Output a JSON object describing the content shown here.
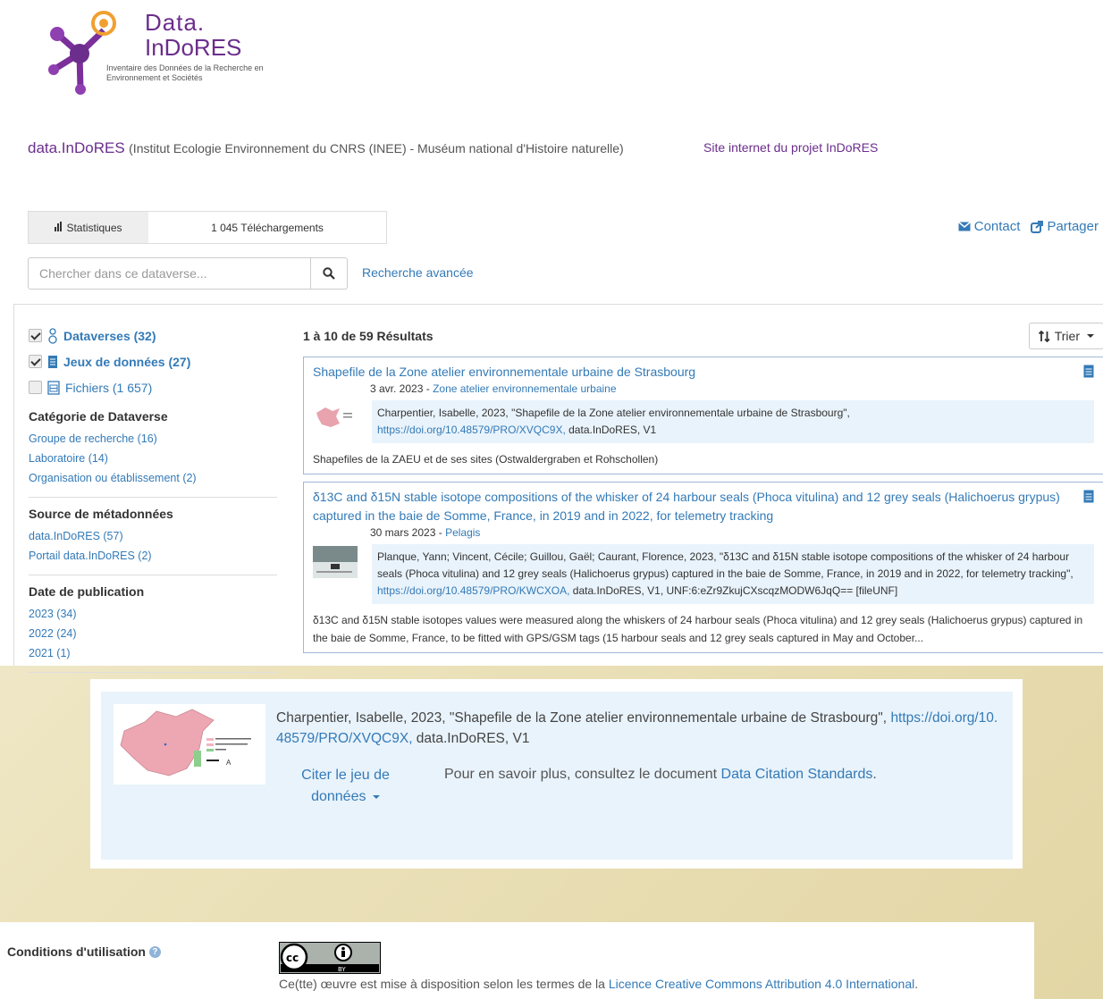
{
  "logo": {
    "line1": "Data.",
    "line2": "InDoRES",
    "line3": "Inventaire des Données de la Recherche en Environnement et Sociétés"
  },
  "header": {
    "brand": "data.InDoRES",
    "subtitle": "(Institut Ecologie Environnement du CNRS (INEE) - Muséum national d'Histoire naturelle)",
    "site_link": "Site internet du projet InDoRES"
  },
  "stats": {
    "label": "Statistiques",
    "downloads": "1 045 Téléchargements"
  },
  "toplinks": {
    "contact": "Contact",
    "share": "Partager"
  },
  "search": {
    "placeholder": "Chercher dans ce dataverse...",
    "advanced": "Recherche avancée"
  },
  "facets": {
    "types": [
      {
        "label": "Dataverses (32)",
        "checked": true
      },
      {
        "label": "Jeux de données (27)",
        "checked": true
      },
      {
        "label": "Fichiers (1 657)",
        "checked": false
      }
    ],
    "groups": [
      {
        "title": "Catégorie de Dataverse",
        "items": [
          "Groupe de recherche (16)",
          "Laboratoire (14)",
          "Organisation ou établissement (2)"
        ]
      },
      {
        "title": "Source de métadonnées",
        "items": [
          "data.InDoRES (57)",
          "Portail data.InDoRES (2)"
        ]
      },
      {
        "title": "Date de publication",
        "items": [
          "2023 (34)",
          "2022 (24)",
          "2021 (1)"
        ]
      }
    ]
  },
  "results": {
    "count": "1 à 10 de 59 Résultats",
    "sort": "Trier",
    "items": [
      {
        "title": "Shapefile de la Zone atelier environnementale urbaine de Strasbourg",
        "date": "3 avr. 2023 -",
        "dataverse": "Zone atelier environnementale urbaine",
        "cite_text": "Charpentier, Isabelle, 2023, \"Shapefile de la Zone atelier environnementale urbaine de Strasbourg\",",
        "cite_doi": "https://doi.org/10.48579/PRO/XVQC9X,",
        "cite_tail": " data.InDoRES, V1",
        "desc": "Shapefiles de la ZAEU et de ses sites (Ostwaldergraben et Rohschollen)"
      },
      {
        "title": "δ13C and δ15N stable isotope compositions of the whisker of 24 harbour seals (Phoca vitulina) and 12 grey seals (Halichoerus grypus) captured in the baie de Somme, France, in 2019 and in 2022, for telemetry tracking",
        "date": "30 mars 2023 -",
        "dataverse": "Pelagis",
        "cite_text": "Planque, Yann; Vincent, Cécile; Guillou, Gaël; Caurant, Florence, 2023, \"δ13C and δ15N stable isotope compositions of the whisker of 24 harbour seals (Phoca vitulina) and 12 grey seals (Halichoerus grypus) captured in the baie de Somme, France, in 2019 and in 2022, for telemetry tracking\",",
        "cite_doi": "https://doi.org/10.48579/PRO/KWCXOA,",
        "cite_tail": " data.InDoRES, V1, UNF:6:eZr9ZkujCXscqzMODW6JqQ== [fileUNF]",
        "desc": "δ13C and δ15N stable isotopes values were measured along the whiskers of 24 harbour seals (Phoca vitulina) and 12 grey seals (Halichoerus grypus) captured in the baie de Somme, France, to be fitted with GPS/GSM tags (15 harbour seals and 12 grey seals captured in May and October..."
      }
    ]
  },
  "citation": {
    "text": "Charpentier, Isabelle, 2023, \"Shapefile de la Zone atelier environnementale urbaine de Strasbourg\",",
    "doi": "https://doi.org/10.48579/PRO/XVQC9X,",
    "tail": " data.InDoRES, V1",
    "cite_button": "Citer le jeu de données",
    "info_prefix": "Pour en savoir plus, consultez le document",
    "info_link": "Data Citation Standards",
    "info_suffix": "."
  },
  "license": {
    "label": "Conditions d'utilisation",
    "text_prefix": "Ce(tte) œuvre est mise à disposition selon les termes de la",
    "link": "Licence Creative Commons Attribution 4.0 International",
    "suffix": "."
  },
  "colors": {
    "brand": "#6b2e8c",
    "link": "#337ab7",
    "cite_bg": "#e9f3fb"
  }
}
